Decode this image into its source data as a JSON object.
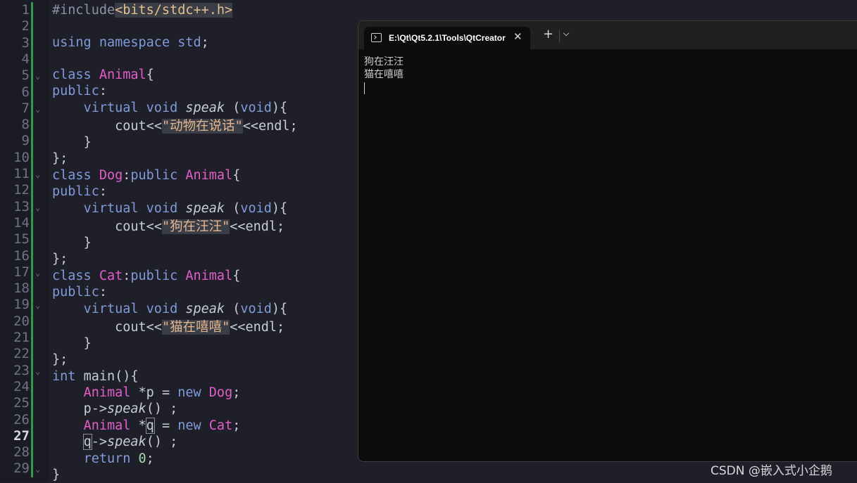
{
  "editor": {
    "line_numbers": [
      "1",
      "2",
      "3",
      "4",
      "5",
      "6",
      "7",
      "8",
      "9",
      "10",
      "11",
      "12",
      "13",
      "14",
      "15",
      "16",
      "17",
      "18",
      "19",
      "20",
      "21",
      "22",
      "23",
      "24",
      "25",
      "26",
      "27",
      "28",
      "29"
    ],
    "current_line": "27",
    "code": {
      "l1_directive": "#include",
      "l1_header": "<bits/stdc++.h>",
      "l3_using": "using",
      "l3_namespace": "namespace",
      "l3_std": "std",
      "l3_semi": ";",
      "kw_class": "class",
      "kw_public": "public",
      "colon": ":",
      "kw_virtual": "virtual",
      "kw_void": "void",
      "fn_speak": "speak",
      "lbrace": "{",
      "rbrace": "}",
      "close_class": "};",
      "cout": "cout<<",
      "endl": "<<endl;",
      "ty_animal": "Animal",
      "ty_dog": "Dog",
      "ty_cat": "Cat",
      "str_animal": "\"动物在说话\"",
      "str_dog": "\"狗在汪汪\"",
      "str_cat": "\"猫在嘻嘻\"",
      "kw_int": "int",
      "main_sig": "main(){",
      "ptr_p": "*p",
      "ptr_star": "*",
      "var_q": "q",
      "assign": "=",
      "kw_new": "new",
      "semi": ";",
      "p_arrow": "p->",
      "arrow": "->",
      "call": "()",
      "call_semi": " ;",
      "kw_return": "return",
      "zero": "0",
      "void_open": "(",
      "void_close": "){"
    }
  },
  "terminal": {
    "tab_title": "E:\\Qt\\Qt5.2.1\\Tools\\QtCreator",
    "close_glyph": "✕",
    "new_tab_glyph": "+",
    "output": [
      "狗在汪汪",
      "猫在嘻嘻"
    ]
  },
  "watermark": "CSDN @嵌入式小企鹅",
  "colors": {
    "keyword": "#7f9bd9",
    "type": "#e35ec8",
    "string": "#e3b68f",
    "number": "#a5d7b0",
    "modified_bar": "#2e9a4c",
    "terminal_bg": "#0c0c0c"
  }
}
